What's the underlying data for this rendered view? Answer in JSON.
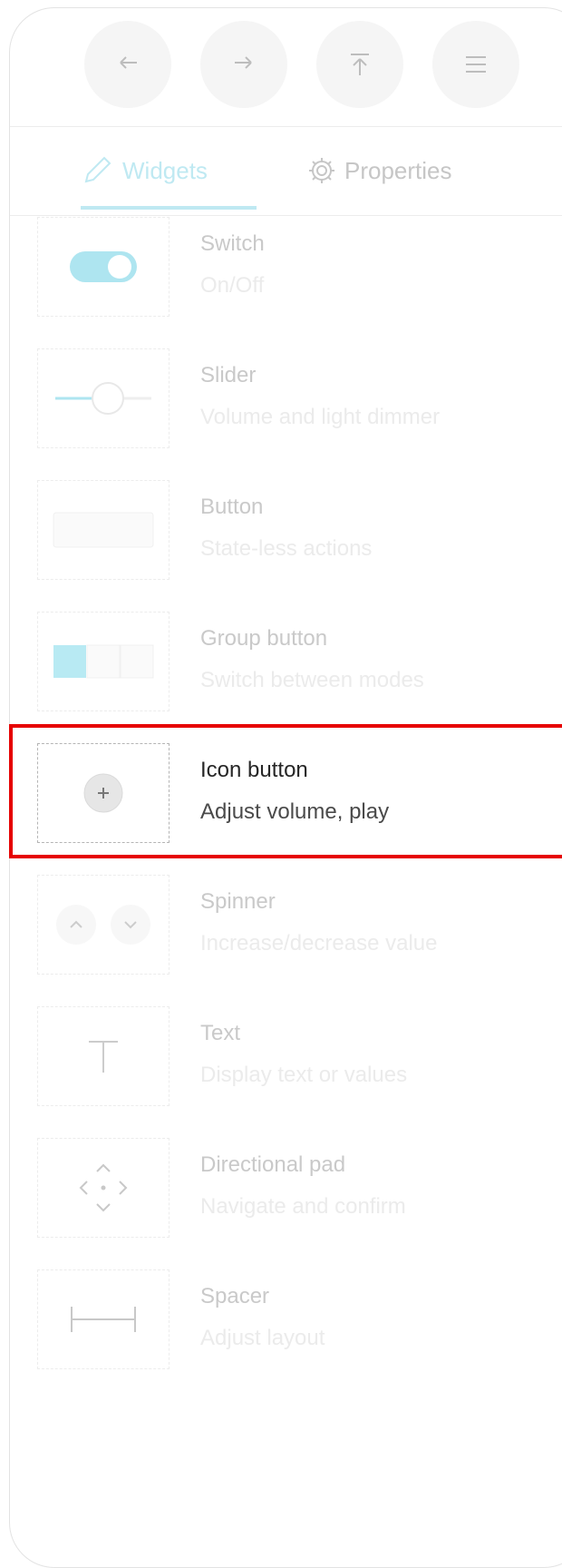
{
  "toolbar": {
    "buttons": [
      "undo-icon",
      "redo-icon",
      "upload-icon",
      "menu-icon"
    ]
  },
  "tabs": [
    {
      "label": "Widgets",
      "icon": "pencil-icon",
      "active": true
    },
    {
      "label": "Properties",
      "icon": "gear-icon",
      "active": false
    }
  ],
  "widgets": [
    {
      "name": "Switch",
      "desc": "On/Off",
      "icon": "switch-preview"
    },
    {
      "name": "Slider",
      "desc": "Volume and light dimmer",
      "icon": "slider-preview"
    },
    {
      "name": "Button",
      "desc": "State-less actions",
      "icon": "button-preview"
    },
    {
      "name": "Group button",
      "desc": "Switch between modes",
      "icon": "group-button-preview"
    },
    {
      "name": "Icon button",
      "desc": "Adjust volume, play",
      "icon": "plus-icon",
      "highlighted": true
    },
    {
      "name": "Spinner",
      "desc": "Increase/decrease value",
      "icon": "spinner-preview"
    },
    {
      "name": "Text",
      "desc": "Display text or values",
      "icon": "text-icon"
    },
    {
      "name": "Directional pad",
      "desc": "Navigate and confirm",
      "icon": "dpad-icon"
    },
    {
      "name": "Spacer",
      "desc": "Adjust layout",
      "icon": "spacer-icon"
    }
  ],
  "colors": {
    "accent": "#bfe9f2",
    "highlight": "#e60000"
  }
}
